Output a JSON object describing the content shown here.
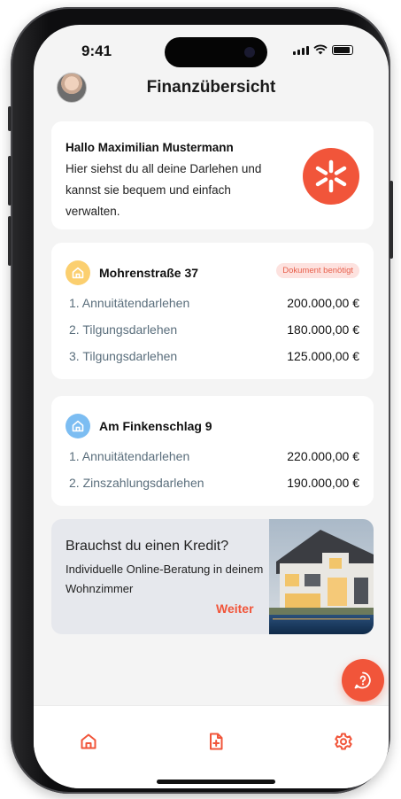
{
  "status": {
    "time": "9:41"
  },
  "header": {
    "title": "Finanzübersicht"
  },
  "welcome": {
    "greeting": "Hallo Maximilian Mustermann",
    "description": "Hier siehst du all deine Darlehen und kannst sie bequem und einfach verwalten."
  },
  "properties": [
    {
      "name": "Mohrenstraße 37",
      "badge": "Dokument benötigt",
      "icon_color": "#fbbf49",
      "loans": [
        {
          "label": "1. Annuitätendarlehen",
          "value": "200.000,00 €"
        },
        {
          "label": "2. Tilgungsdarlehen",
          "value": "180.000,00 €"
        },
        {
          "label": "3. Tilgungsdarlehen",
          "value": "125.000,00 €"
        }
      ]
    },
    {
      "name": "Am Finkenschlag 9",
      "icon_color": "#5aaef0",
      "loans": [
        {
          "label": "1. Annuitätendarlehen",
          "value": "220.000,00 €"
        },
        {
          "label": "2. Zinszahlungsdarlehen",
          "value": "190.000,00 €"
        }
      ]
    }
  ],
  "promo": {
    "title": "Brauchst du einen Kredit?",
    "description": "Individuelle Online-Beratung in deinem Wohnzimmer",
    "link": "Weiter",
    "image": "house-photo"
  },
  "tabbar": {
    "items": [
      {
        "icon": "home-icon"
      },
      {
        "icon": "add-document-icon"
      },
      {
        "icon": "settings-icon"
      }
    ]
  },
  "colors": {
    "accent": "#f1553a",
    "background": "#f4f4f4",
    "card": "#ffffff"
  }
}
